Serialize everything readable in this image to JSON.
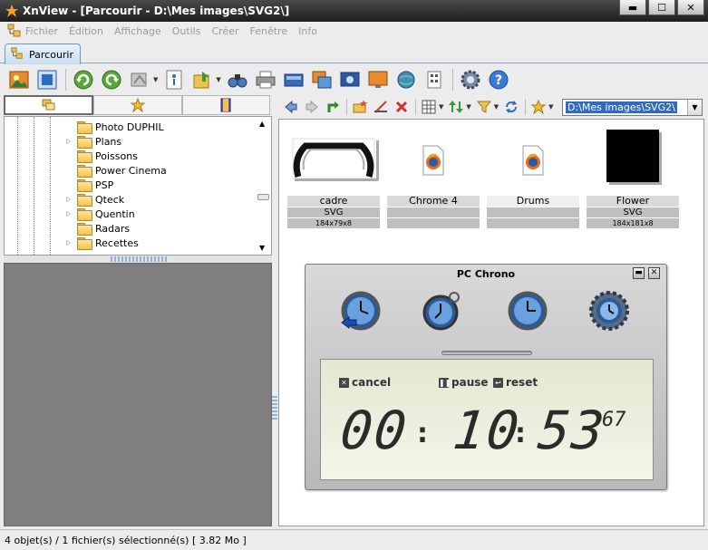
{
  "window": {
    "title": "XnView - [Parcourir - D:\\Mes images\\SVG2\\]",
    "buttons": {
      "minimize": "▬",
      "maximize": "☐",
      "close": "✕"
    }
  },
  "menu": [
    "Fichier",
    "Édition",
    "Affichage",
    "Outils",
    "Créer",
    "Fenêtre",
    "Info"
  ],
  "tab": {
    "label": "Parcourir"
  },
  "folder_tree": {
    "items": [
      {
        "label": "Photo DUPHIL",
        "expandable": false
      },
      {
        "label": "Plans",
        "expandable": true
      },
      {
        "label": "Poissons",
        "expandable": false
      },
      {
        "label": "Power Cinema",
        "expandable": false
      },
      {
        "label": "PSP",
        "expandable": false
      },
      {
        "label": "Qteck",
        "expandable": true
      },
      {
        "label": "Quentin",
        "expandable": true
      },
      {
        "label": "Radars",
        "expandable": false
      },
      {
        "label": "Recettes",
        "expandable": true
      }
    ]
  },
  "path": {
    "value": "D:\\Mes images\\SVG2\\"
  },
  "thumbnails": [
    {
      "name": "cadre",
      "format": "SVG",
      "dims": "184x79x8",
      "kind": "frame"
    },
    {
      "name": "Chrome 4",
      "format": "",
      "dims": "",
      "kind": "firefox"
    },
    {
      "name": "Drums",
      "format": "",
      "dims": "",
      "kind": "firefox"
    },
    {
      "name": "Flower",
      "format": "SVG",
      "dims": "184x181x8",
      "kind": "black"
    }
  ],
  "chrono": {
    "title": "PC Chrono",
    "min_btn": "▬",
    "close_btn": "✕",
    "cancel": "cancel",
    "pause": "pause",
    "reset": "reset",
    "hours": "00",
    "minutes": "10",
    "seconds": "53",
    "hundredths": "67",
    "colon": ":"
  },
  "status": {
    "text": "4 objet(s) / 1 fichier(s) sélectionné(s)  [ 3.82 Mo ]"
  },
  "colors": {
    "accent": "#316ac5",
    "titlebar": "#2a2a2a",
    "preview_bg": "#7f7f7f"
  }
}
